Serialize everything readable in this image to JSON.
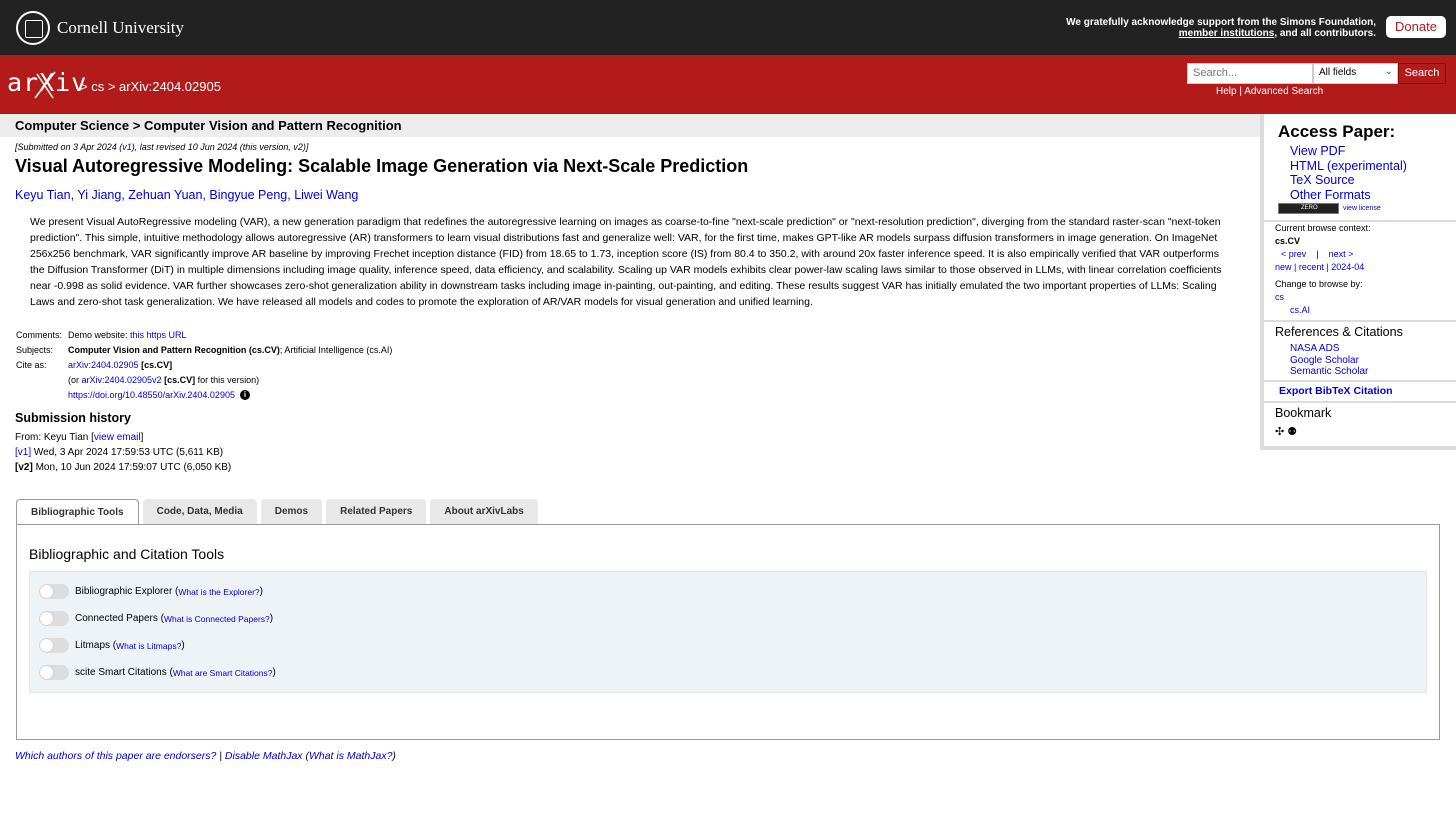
{
  "header": {
    "university": "Cornell University",
    "acknowledgement_prefix": "We gratefully acknowledge support from the Simons Foundation, ",
    "acknowledgement_link": "member institutions",
    "acknowledgement_suffix": ", and all contributors.",
    "donate_label": "Donate",
    "logo_text": "arXiv",
    "breadcrumb": "> cs > arXiv:2404.02905",
    "search_placeholder": "Search...",
    "search_field_selected": "All fields",
    "search_button": "Search",
    "help_label": "Help",
    "help_separator": "|",
    "advanced_search_label": "Advanced Search",
    "brand_color": "#b31b1b"
  },
  "paper": {
    "subject_heading": "Computer Science > Computer Vision and Pattern Recognition",
    "dateline_prefix": "[Submitted on 3 Apr 2024 (",
    "dateline_v1": "v1",
    "dateline_suffix": "), last revised 10 Jun 2024 (this version, v2)]",
    "title": "Visual Autoregressive Modeling: Scalable Image Generation via Next-Scale Prediction",
    "authors": [
      "Keyu Tian",
      "Yi Jiang",
      "Zehuan Yuan",
      "Bingyue Peng",
      "Liwei Wang"
    ],
    "abstract": "We present Visual AutoRegressive modeling (VAR), a new generation paradigm that redefines the autoregressive learning on images as coarse-to-fine \"next-scale prediction\" or \"next-resolution prediction\", diverging from the standard raster-scan \"next-token prediction\". This simple, intuitive methodology allows autoregressive (AR) transformers to learn visual distributions fast and generalize well: VAR, for the first time, makes GPT-like AR models surpass diffusion transformers in image generation. On ImageNet 256x256 benchmark, VAR significantly improve AR baseline by improving Frechet inception distance (FID) from 18.65 to 1.73, inception score (IS) from 80.4 to 350.2, with around 20x faster inference speed. It is also empirically verified that VAR outperforms the Diffusion Transformer (DiT) in multiple dimensions including image quality, inference speed, data efficiency, and scalability. Scaling up VAR models exhibits clear power-law scaling laws similar to those observed in LLMs, with linear correlation coefficients near -0.998 as solid evidence. VAR further showcases zero-shot generalization ability in downstream tasks including image in-painting, out-painting, and editing. These results suggest VAR has initially emulated the two important properties of LLMs: Scaling Laws and zero-shot task generalization. We have released all models and codes to promote the exploration of AR/VAR models for visual generation and unified learning.",
    "comments_label": "Comments:",
    "comments_text": "Demo website: ",
    "comments_link": "this https URL",
    "subjects_label": "Subjects:",
    "subjects_primary": "Computer Vision and Pattern Recognition (cs.CV)",
    "subjects_rest": "; Artificial Intelligence (cs.AI)",
    "cite_label": "Cite as:",
    "cite_id": "arXiv:2404.02905",
    "cite_cat": "[cs.CV]",
    "cite_or_prefix": "(or ",
    "cite_v2": "arXiv:2404.02905v2",
    "cite_v2_cat": "[cs.CV]",
    "cite_v2_suffix": " for this version)",
    "doi": "https://doi.org/10.48550/arXiv.2404.02905",
    "history_title": "Submission history",
    "history_from": "From: Keyu Tian [",
    "history_email": "view email",
    "history_from_end": "]",
    "versions": [
      {
        "tag": "[v1]",
        "text": " Wed, 3 Apr 2024 17:59:53 UTC (5,611 KB)"
      },
      {
        "tag": "[v2]",
        "text": " Mon, 10 Jun 2024 17:59:07 UTC (6,050 KB)"
      }
    ]
  },
  "tabs": [
    "Bibliographic Tools",
    "Code, Data, Media",
    "Demos",
    "Related Papers",
    "About arXivLabs"
  ],
  "tools_panel": {
    "title": "Bibliographic and Citation Tools",
    "tools": [
      {
        "name": "Bibliographic Explorer",
        "help": "What is the Explorer?"
      },
      {
        "name": "Connected Papers",
        "help": "What is Connected Papers?"
      },
      {
        "name": "Litmaps",
        "help": "What is Litmaps?"
      },
      {
        "name": "scite Smart Citations",
        "help": "What are Smart Citations?"
      }
    ]
  },
  "footer": {
    "endorsers": "Which authors of this paper are endorsers?",
    "sep": " | ",
    "mathjax": "Disable MathJax",
    "mathjax_help": "What is MathJax?"
  },
  "sidebar": {
    "access_title": "Access Paper:",
    "access_links": [
      "View PDF",
      "HTML (experimental)",
      "TeX Source",
      "Other Formats"
    ],
    "license_badge": "ZERO",
    "view_license": "view license",
    "browse_context_label": "Current browse context:",
    "browse_context": "cs.CV",
    "prev": "< prev",
    "next": "next >",
    "browse_sep": "|",
    "new": "new",
    "recent": "recent",
    "date": "2024-04",
    "change_browse": "Change to browse by:",
    "browse_cats": [
      "cs",
      "cs.AI"
    ],
    "refs_title": "References & Citations",
    "refs": [
      "NASA ADS",
      "Google Scholar",
      "Semantic Scholar"
    ],
    "export": "Export BibTeX Citation",
    "bookmark_title": "Bookmark"
  }
}
